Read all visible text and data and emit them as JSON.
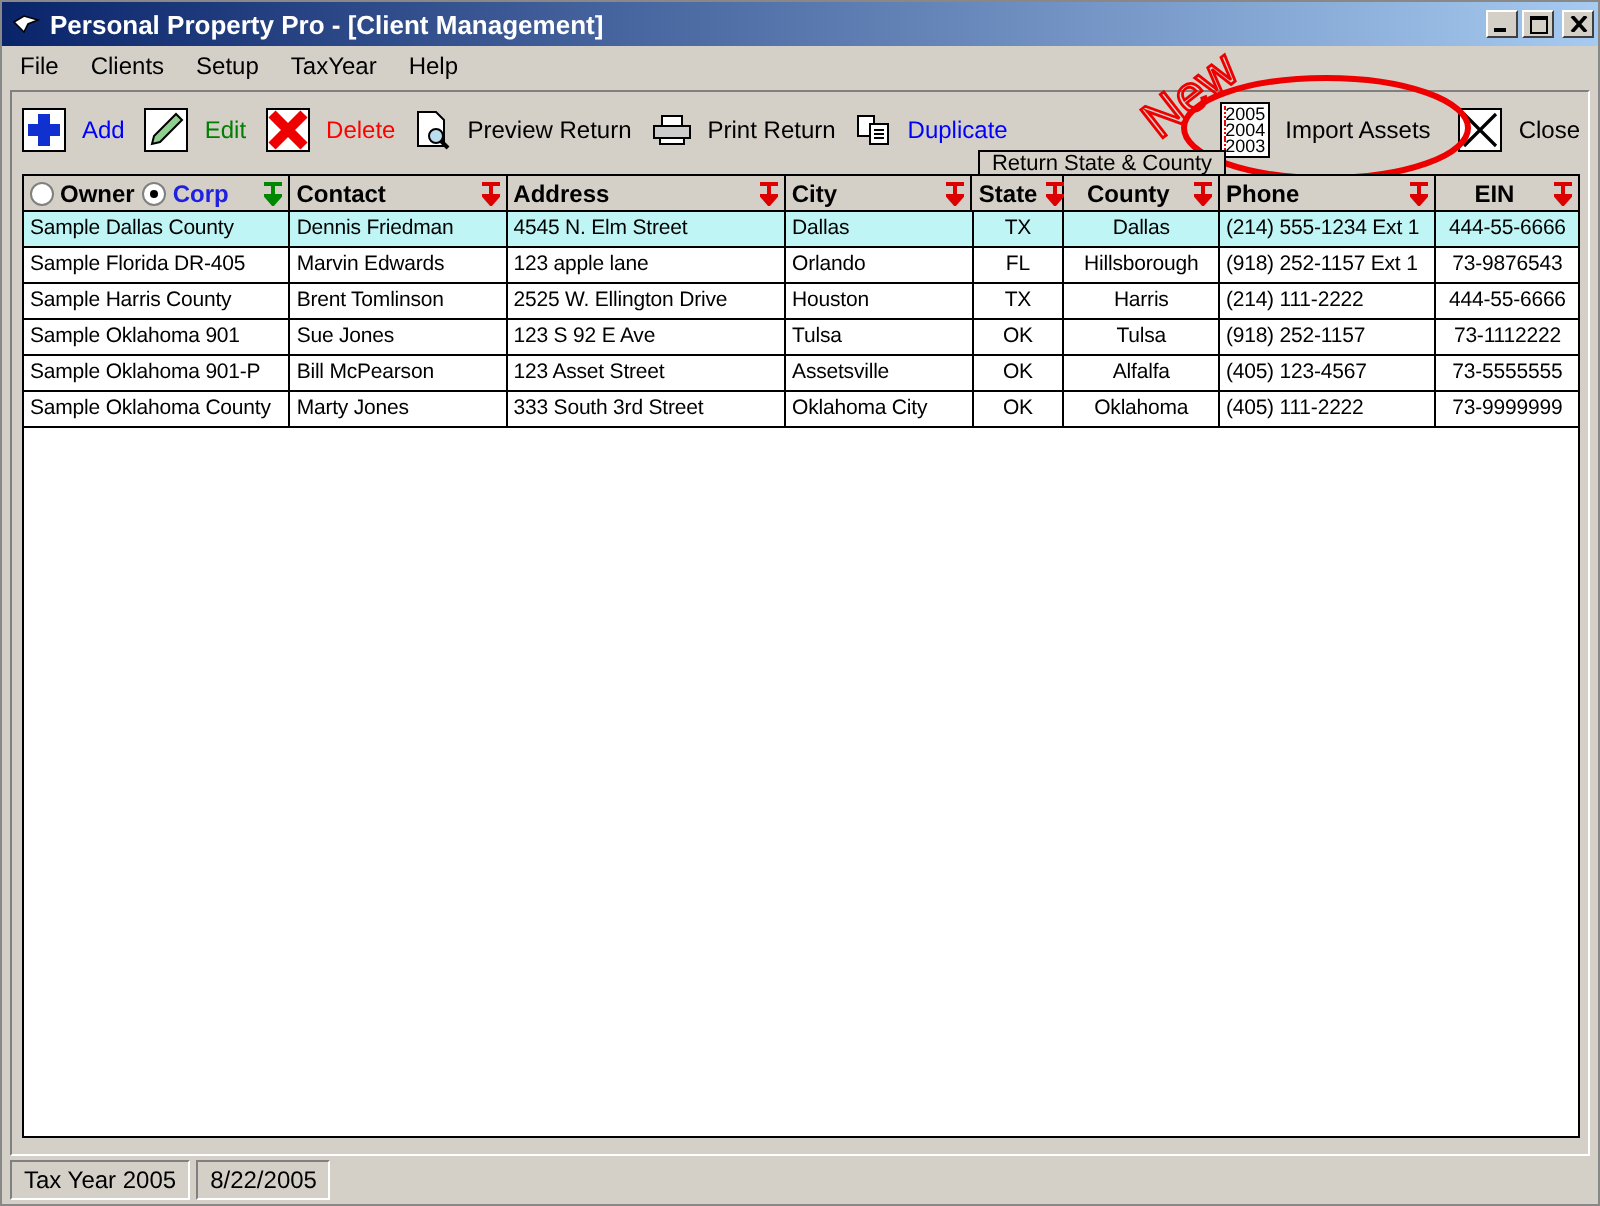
{
  "window": {
    "title": "Personal Property Pro - [Client Management]"
  },
  "menu": [
    "File",
    "Clients",
    "Setup",
    "TaxYear",
    "Help"
  ],
  "toolbar": [
    {
      "kind": "add",
      "label": "Add",
      "color": "#0000ff"
    },
    {
      "kind": "edit",
      "label": "Edit",
      "color": "#008000"
    },
    {
      "kind": "delete",
      "label": "Delete",
      "color": "#ff0000"
    },
    {
      "kind": "preview",
      "label": "Preview Return",
      "color": "#000000"
    },
    {
      "kind": "print",
      "label": "Print Return",
      "color": "#000000"
    },
    {
      "kind": "duplicate",
      "label": "Duplicate",
      "color": "#0000ff"
    }
  ],
  "import": {
    "years": [
      "2005",
      "2004",
      "2003"
    ],
    "label": "Import Assets",
    "badge": "New"
  },
  "close": {
    "label": "Close"
  },
  "group_header": "Return State & County",
  "filter": [
    {
      "label": "Owner",
      "selected": false
    },
    {
      "label": "Corp",
      "selected": true
    }
  ],
  "columns": [
    {
      "label": "Contact",
      "sorted": false
    },
    {
      "label": "Address",
      "sorted": false
    },
    {
      "label": "City",
      "sorted": false
    },
    {
      "label": "State",
      "sorted": false
    },
    {
      "label": "County",
      "sorted": false
    },
    {
      "label": "Phone",
      "sorted": false
    },
    {
      "label": "EIN",
      "sorted": false
    }
  ],
  "first_column_sorted": true,
  "rows": [
    {
      "selected": true,
      "cells": [
        "Sample Dallas County",
        "Dennis Friedman",
        "4545 N. Elm Street",
        "Dallas",
        "TX",
        "Dallas",
        "(214) 555-1234 Ext 1",
        "444-55-6666"
      ]
    },
    {
      "selected": false,
      "cells": [
        "Sample Florida DR-405",
        "Marvin Edwards",
        "123 apple lane",
        "Orlando",
        "FL",
        "Hillsborough",
        "(918) 252-1157 Ext 1",
        "73-9876543"
      ]
    },
    {
      "selected": false,
      "cells": [
        "Sample Harris County",
        "Brent Tomlinson",
        "2525 W. Ellington Drive",
        "Houston",
        "TX",
        "Harris",
        "(214) 111-2222",
        "444-55-6666"
      ]
    },
    {
      "selected": false,
      "cells": [
        "Sample Oklahoma 901",
        "Sue Jones",
        "123 S 92 E Ave",
        "Tulsa",
        "OK",
        "Tulsa",
        "(918) 252-1157",
        "73-1112222"
      ]
    },
    {
      "selected": false,
      "cells": [
        "Sample Oklahoma 901-P",
        "Bill McPearson",
        "123 Asset Street",
        "Assetsville",
        "OK",
        "Alfalfa",
        "(405) 123-4567",
        "73-5555555"
      ]
    },
    {
      "selected": false,
      "cells": [
        "Sample Oklahoma County",
        "Marty Jones",
        "333 South 3rd Street",
        "Oklahoma City",
        "OK",
        "Oklahoma",
        "(405) 111-2222",
        "73-9999999"
      ]
    }
  ],
  "status_bar": [
    "Tax Year 2005",
    "8/22/2005"
  ]
}
